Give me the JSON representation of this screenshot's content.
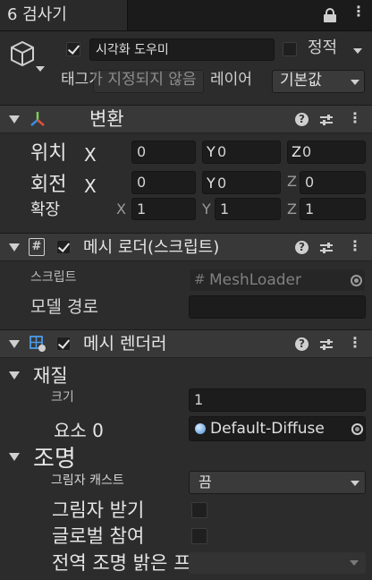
{
  "tab": {
    "title": "6 검사기"
  },
  "header": {
    "active": true,
    "object_name": "시각화 도우미",
    "static_label": "정적",
    "static": false,
    "tag_label": "태그가 지정되지 않음",
    "layer_label": "레이어",
    "layer_value": "기본값"
  },
  "transform": {
    "title": "변환",
    "position": {
      "label": "위치",
      "x": "0",
      "y": "0",
      "z": "0"
    },
    "rotation": {
      "label": "회전",
      "x": "0",
      "y": "0",
      "z": "0"
    },
    "scale": {
      "label": "확장",
      "x": "1",
      "y": "1",
      "z": "1"
    }
  },
  "mesh_loader": {
    "title": "메시 로더(스크립트)",
    "enabled": true,
    "script_label": "스크립트",
    "script_value": "MeshLoader",
    "model_path_label": "모델 경로",
    "model_path_value": ""
  },
  "mesh_renderer": {
    "title": "메시 렌더러",
    "enabled": true,
    "materials_label": "재질",
    "size_label": "크기",
    "size_value": "1",
    "element_label": "요소 0",
    "element_value": "Default-Diffuse",
    "lighting_label": "조명",
    "cast_shadows_label": "그림자 캐스트",
    "cast_shadows_value": "끔",
    "receive_shadows_label": "그림자 받기",
    "receive_shadows": false,
    "contribute_gi_label": "글로벌 참여",
    "contribute_gi": false,
    "light_probes_label": "전역 조명 밝은 프로브"
  },
  "axis": {
    "x": "X",
    "y": "Y",
    "z": "Z"
  }
}
